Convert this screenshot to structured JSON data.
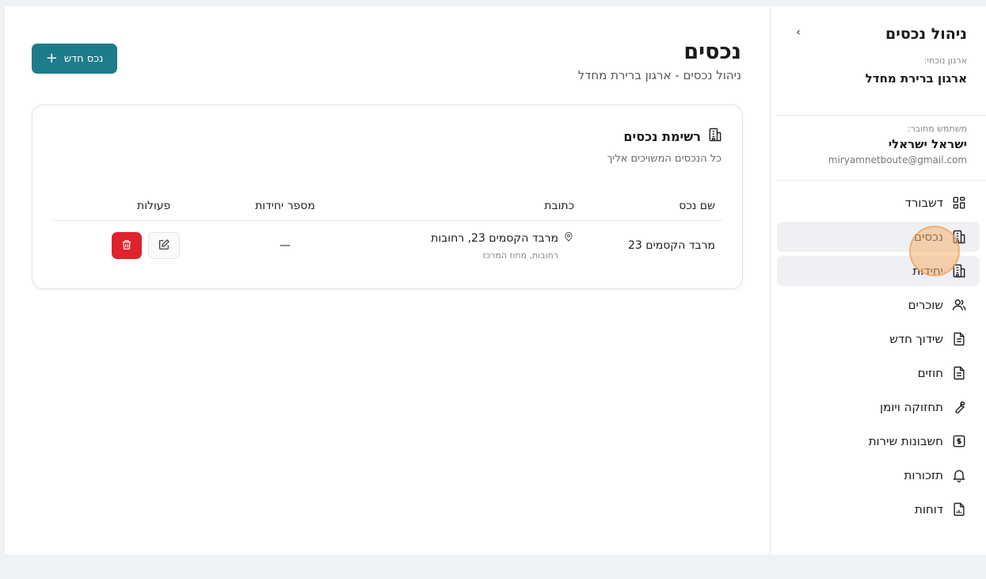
{
  "sidebar": {
    "title": "ניהול נכסים",
    "collapse_icon": "chevron-right-icon",
    "org_label": "ארגון נוכחי:",
    "org_name": "ארגון ברירת מחדל",
    "user_label": "משתמש מחובר:",
    "user_name": "ישראל ישראלי",
    "user_email": "miryamnetboute@gmail.com",
    "items": [
      {
        "label": "דשבורד",
        "icon": "dashboard-icon"
      },
      {
        "label": "נכסים",
        "icon": "building-icon",
        "active": true
      },
      {
        "label": "יחידות",
        "icon": "building-icon",
        "active": true
      },
      {
        "label": "שוכרים",
        "icon": "users-icon"
      },
      {
        "label": "שידוך חדש",
        "icon": "document-icon"
      },
      {
        "label": "חוזים",
        "icon": "document-icon"
      },
      {
        "label": "תחזוקה ויומן",
        "icon": "wrench-icon"
      },
      {
        "label": "חשבונות שירות",
        "icon": "dollar-icon"
      },
      {
        "label": "תזכורות",
        "icon": "bell-icon"
      },
      {
        "label": "דוחות",
        "icon": "report-icon"
      }
    ]
  },
  "header": {
    "title": "נכסים",
    "subtitle": "ניהול נכסים - ארגון ברירת מחדל",
    "new_button_label": "נכס חדש"
  },
  "card": {
    "title": "רשימת נכסים",
    "description": "כל הנכסים המשויכים אליך",
    "columns": {
      "name": "שם נכס",
      "address": "כתובת",
      "units": "מספר יחידות",
      "actions": "פעולות"
    },
    "rows": [
      {
        "name": "מרבד הקסמים 23",
        "address": "מרבד הקסמים 23, רחובות",
        "address_sub": "רחובות, מחוז המרכז",
        "units": "—"
      }
    ]
  },
  "colors": {
    "primary": "#1d7c8a",
    "danger": "#e0222c",
    "background": "#eef1f6"
  }
}
